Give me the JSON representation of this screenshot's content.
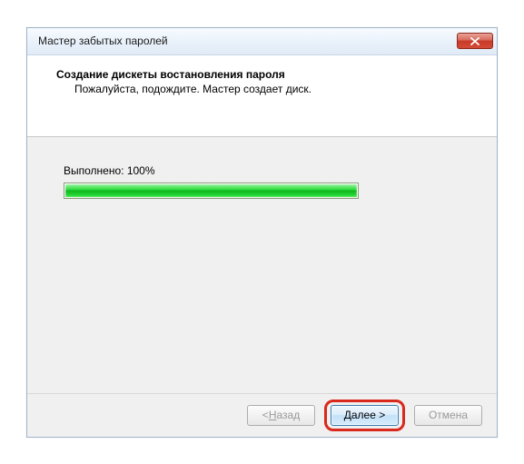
{
  "window": {
    "title": "Мастер забытых паролей"
  },
  "header": {
    "title": "Создание дискеты востановления пароля",
    "subtitle": "Пожалуйста, подождите. Мастер создает диск."
  },
  "progress": {
    "label_prefix": "Выполнено:",
    "percent_text": "100%",
    "percent_value": 100
  },
  "buttons": {
    "back_prefix": "< ",
    "back_u": "Н",
    "back_rest": "азад",
    "next_u": "Д",
    "next_rest": "алее >",
    "cancel": "Отмена"
  }
}
